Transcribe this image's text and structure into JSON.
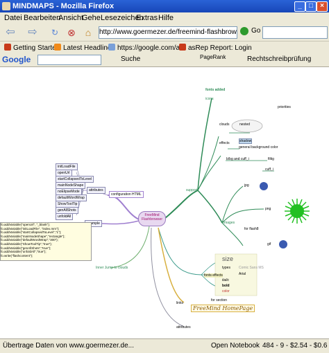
{
  "window": {
    "title": "MINDMAPS - Mozilla Firefox"
  },
  "menu": [
    "Datei",
    "Bearbeiten",
    "Ansicht",
    "Gehe",
    "Lesezeichen",
    "Extras",
    "Hilfe"
  ],
  "nav": {
    "url": "http://www.goermezer.de/freemind-flashbrowser.",
    "go_label": "Go"
  },
  "bookmarks": [
    "Getting Started",
    "Latest Headlines",
    "https://google.com/a...",
    "asRep Report: Login"
  ],
  "google_toolbar": {
    "logo": "Google",
    "search_label": "Suche",
    "pagerank_label": "PageRank",
    "spellcheck_label": "Rechtschreibprüfung"
  },
  "mindmap": {
    "root": "FreeMind Flashbrowser",
    "left": {
      "config_node": "configuration HTML",
      "attributes": [
        "initLoadFile",
        "openUrl",
        "startCollapsedToLevel",
        "mainNodeShape",
        "noElipseMode",
        "defaultWordWrap",
        "ShowToolTip",
        "genAllShots",
        "unfoldAll"
      ],
      "attributes_label": "attributes",
      "example_label": "example",
      "code_lines": [
        "fo.addVariable(\"openUrl\", \"_blank\");",
        "fo.addVariable(\"initLoadFile\", \"index.mm\");",
        "fo.addVariable(\"startCollapsedToLevel\",\"1\");",
        "fo.addVariable(\"mainNodeShape\",\"rectangle\");",
        "fo.addVariable(\"defaultWordWrap\",\"300\");",
        "fo.addVariable(\"ShowToolTip\",\"true\");",
        "fo.addVariable(\"genAllShots\",\"true\");",
        "fo.addVariable(\"unfoldAll\",\"true\");",
        "fo.write(\"flashcontent\");"
      ],
      "inner_jump": "Inner Jump to clouds"
    },
    "right": {
      "support": "support",
      "fonts_added": "fonts added",
      "icons": "icons",
      "priorities": "priorities",
      "clouds": "clouds",
      "nested": "nested",
      "effects": "effects",
      "shadow": "shadow",
      "bg_color": "general background color",
      "bbold": "b/bg and cuff_i",
      "filtter": "filtig",
      "cuff": "cuff_i",
      "images": "images",
      "jpg": "jpg",
      "png": "png",
      "gif": "gif",
      "for_flash": "for flash8",
      "size": "size",
      "types": "types",
      "arial": "Arial",
      "italic": "italic",
      "bold": "bold",
      "color": "color",
      "comic": "Comic Sans MS",
      "fonts_effects": "fonts effects",
      "links": "links",
      "for_section": "for section",
      "freemind_homepage": "FreeMind HomePage",
      "attributes": "attributes"
    }
  },
  "status": {
    "text": "Übertrage Daten von www.goermezer.de...",
    "notebook": "Open Notebook",
    "stock": "484 - 9 - $2.54 - $0.6"
  },
  "colors": {
    "title_bar": "#1f54c7",
    "chrome": "#ece9d8",
    "branch_green": "#2e8b57",
    "branch_lilac": "#a080d0"
  }
}
